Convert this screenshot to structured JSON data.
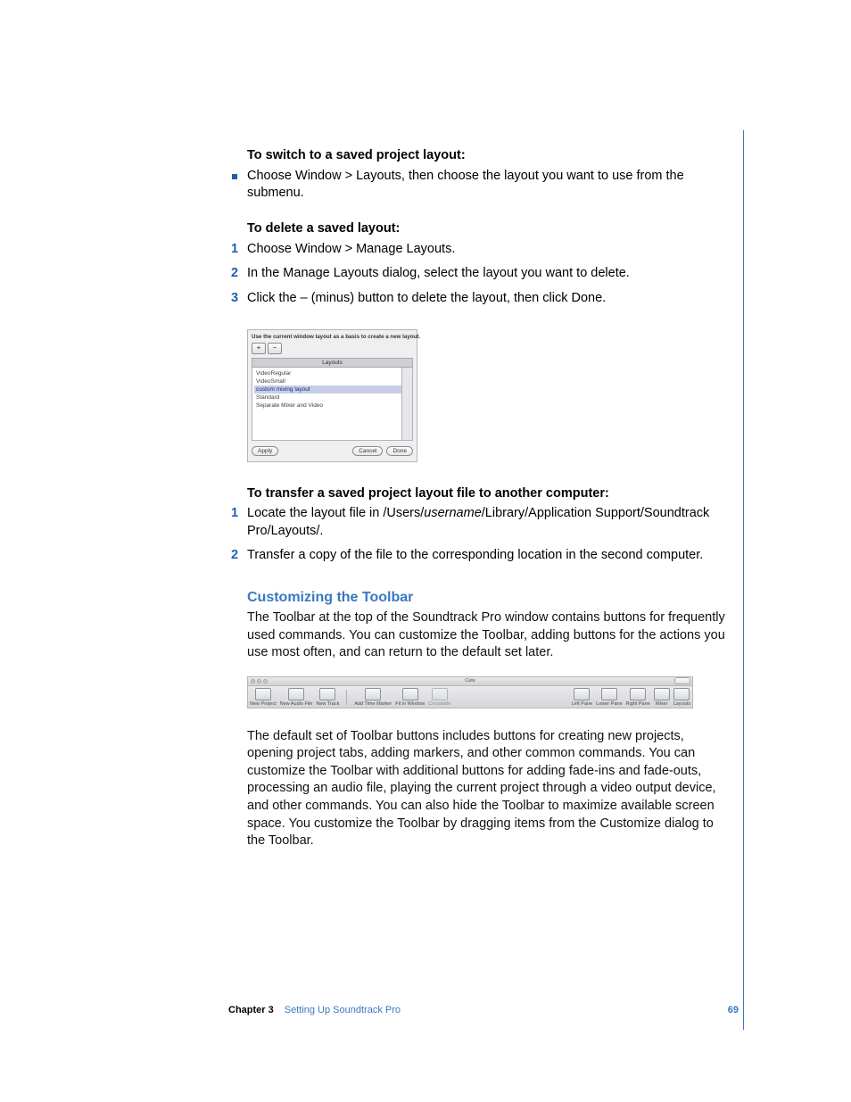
{
  "sections": {
    "switch": {
      "heading": "To switch to a saved project layout:",
      "bullet": "Choose Window > Layouts, then choose the layout you want to use from the submenu."
    },
    "delete": {
      "heading": "To delete a saved layout:",
      "step1": "Choose Window > Manage Layouts.",
      "step2": "In the Manage Layouts dialog, select the layout you want to delete.",
      "step3": "Click the – (minus) button to delete the layout, then click Done."
    },
    "transfer": {
      "heading": "To transfer a saved project layout file to another computer:",
      "step1_a": "Locate the layout file in /Users/",
      "step1_user": "username",
      "step1_b": "/Library/Application Support/Soundtrack Pro/Layouts/.",
      "step2": "Transfer a copy of the file to the corresponding location in the second computer."
    },
    "customize": {
      "heading": "Customizing the Toolbar",
      "para1": "The Toolbar at the top of the Soundtrack Pro window contains buttons for frequently used commands. You can customize the Toolbar, adding buttons for the actions you use most often, and can return to the default set later.",
      "para2": "The default set of Toolbar buttons includes buttons for creating new projects, opening project tabs, adding markers, and other common commands. You can customize the Toolbar with additional buttons for adding fade-ins and fade-outs, processing an audio file, playing the current project through a video output device, and other commands. You can also hide the Toolbar to maximize available screen space. You customize the Toolbar by dragging items from the Customize dialog to the Toolbar."
    }
  },
  "dialog": {
    "caption": "Use the current window layout as a basis to create a new layout.",
    "plus": "+",
    "minus": "−",
    "column": "Layouts",
    "items": {
      "0": "VideoRegular",
      "1": "VideoSmall",
      "2": "custom mixing layout",
      "3": "Standard",
      "4": "Separate Mixer and Video"
    },
    "apply": "Apply",
    "cancel": "Cancel",
    "done": "Done"
  },
  "toolbar": {
    "title": "Cate",
    "left": {
      "0": "New Project",
      "1": "New Audio File",
      "2": "New Track",
      "3": "Add Time Marker",
      "4": "Fit in Window",
      "5": "Crossfade"
    },
    "right": {
      "0": "Left Pane",
      "1": "Lower Pane",
      "2": "Right Pane",
      "3": "Mixer",
      "4": "Layouts"
    }
  },
  "footer": {
    "chapter": "Chapter 3",
    "title": "Setting Up Soundtrack Pro",
    "page": "69"
  },
  "nums": {
    "1": "1",
    "2": "2",
    "3": "3"
  }
}
